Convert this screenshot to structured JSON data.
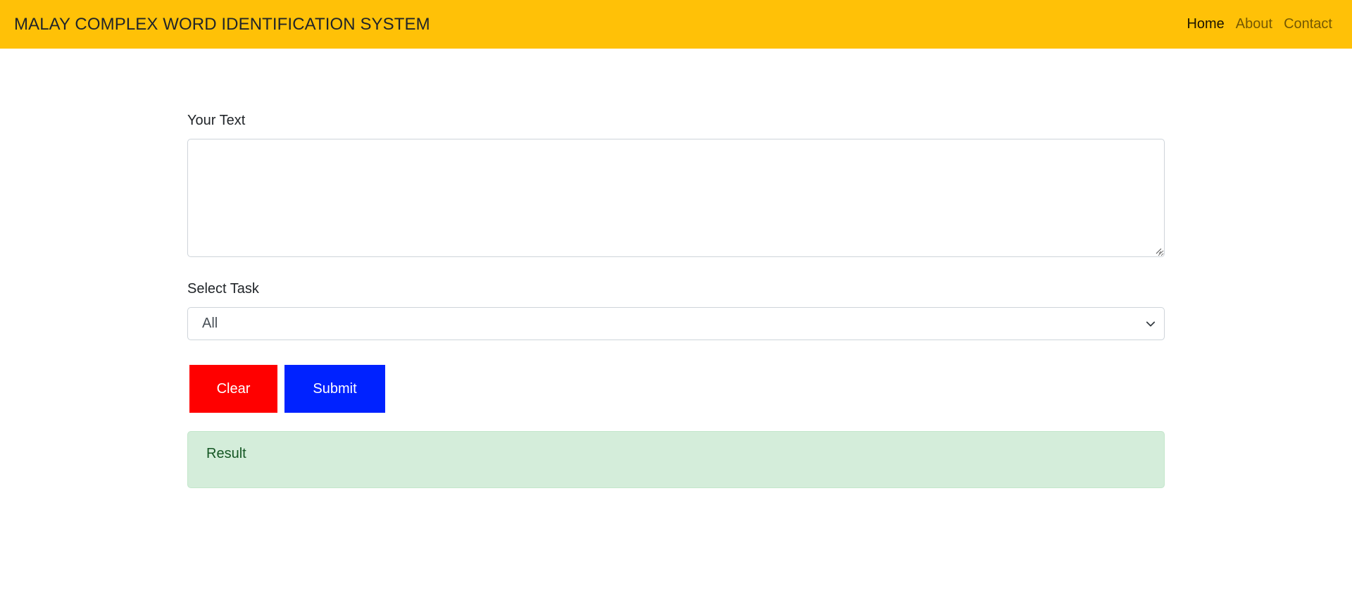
{
  "navbar": {
    "brand": "MALAY COMPLEX WORD IDENTIFICATION SYSTEM",
    "links": [
      {
        "label": "Home",
        "active": true
      },
      {
        "label": "About",
        "active": false
      },
      {
        "label": "Contact",
        "active": false
      }
    ],
    "background_color": "#ffc107"
  },
  "form": {
    "text_label": "Your Text",
    "text_value": "",
    "task_label": "Select Task",
    "task_selected": "All"
  },
  "buttons": {
    "clear_label": "Clear",
    "clear_color": "#ff0000",
    "submit_label": "Submit",
    "submit_color": "#0022ff"
  },
  "result": {
    "label": "Result",
    "background_color": "#d4edda"
  }
}
